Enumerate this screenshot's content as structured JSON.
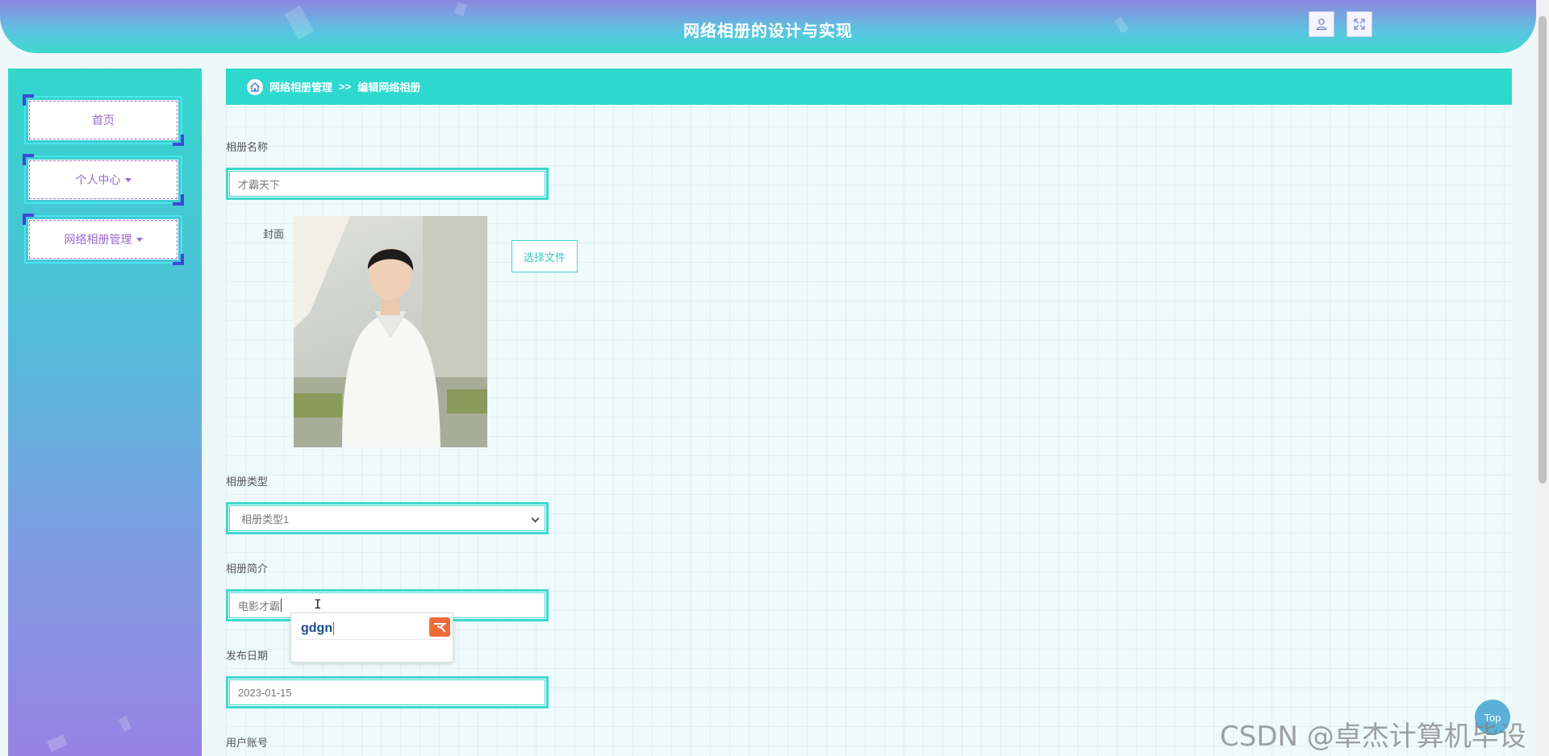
{
  "header": {
    "title": "网络相册的设计与实现",
    "user_icon": "user-icon",
    "fullscreen_icon": "fullscreen-icon"
  },
  "sidebar": {
    "items": [
      {
        "label": "首页",
        "has_caret": false
      },
      {
        "label": "个人中心",
        "has_caret": true
      },
      {
        "label": "网络相册管理",
        "has_caret": true
      }
    ]
  },
  "breadcrumb": {
    "icon": "home-icon",
    "parent": "网络相册管理",
    "separator": ">>",
    "current": "编辑网络相册"
  },
  "form": {
    "album_name": {
      "label": "相册名称",
      "value": "才霸天下"
    },
    "cover": {
      "label": "封面",
      "button": "选择文件"
    },
    "album_type": {
      "label": "相册类型",
      "value": "相册类型1"
    },
    "album_intro": {
      "label": "相册简介",
      "value": "电影才霸"
    },
    "publish_date": {
      "label": "发布日期",
      "value": "2023-01-15"
    },
    "user_account": {
      "label": "用户账号"
    }
  },
  "ime": {
    "composition": "gdgn"
  },
  "top_button": {
    "label": "Top"
  },
  "watermark": "CSDN @卓杰计算机毕设",
  "colors": {
    "accent": "#2dd9cf",
    "menu_text": "#9b68cf",
    "header_top": "#8f86e0"
  }
}
